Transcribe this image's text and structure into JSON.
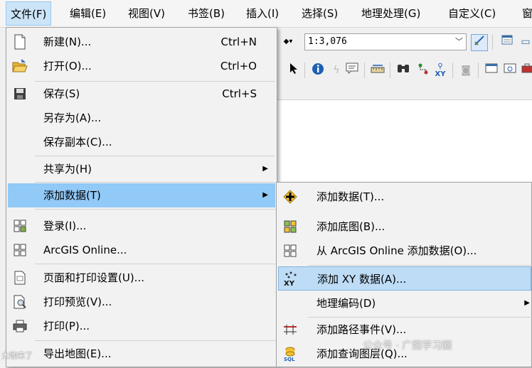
{
  "menubar": {
    "items": [
      "文件(F)",
      "编辑(E)",
      "视图(V)",
      "书签(B)",
      "插入(I)",
      "选择(S)",
      "地理处理(G)",
      "自定义(C)",
      "窗"
    ]
  },
  "toolbar": {
    "scale_value": "1:3,076"
  },
  "file_menu": {
    "items": [
      {
        "label": "新建(N)...",
        "shortcut": "Ctrl+N",
        "icon": "new-document-icon"
      },
      {
        "label": "打开(O)...",
        "shortcut": "Ctrl+O",
        "icon": "open-folder-icon"
      },
      {
        "label": "保存(S)",
        "shortcut": "Ctrl+S",
        "icon": "save-disk-icon"
      },
      {
        "label": "另存为(A)...",
        "shortcut": "",
        "icon": ""
      },
      {
        "label": "保存副本(C)...",
        "shortcut": "",
        "icon": ""
      },
      {
        "label": "共享为(H)",
        "shortcut": "",
        "icon": ""
      },
      {
        "label": "添加数据(T)",
        "shortcut": "",
        "icon": ""
      },
      {
        "label": "登录(I)...",
        "shortcut": "",
        "icon": "sign-in-grid-icon"
      },
      {
        "label": "ArcGIS Online...",
        "shortcut": "",
        "icon": "arcgis-grid-icon"
      },
      {
        "label": "页面和打印设置(U)...",
        "shortcut": "",
        "icon": "page-setup-icon"
      },
      {
        "label": "打印预览(V)...",
        "shortcut": "",
        "icon": "print-preview-icon"
      },
      {
        "label": "打印(P)...",
        "shortcut": "",
        "icon": "printer-icon"
      },
      {
        "label": "导出地图(E)...",
        "shortcut": "",
        "icon": ""
      }
    ]
  },
  "add_data_submenu": {
    "items": [
      {
        "label": "添加数据(T)...",
        "icon": "add-data-plus-icon"
      },
      {
        "label": "添加底图(B)...",
        "icon": "basemap-grid-icon"
      },
      {
        "label": "从 ArcGIS Online 添加数据(O)...",
        "icon": "arcgis-online-grid-icon"
      },
      {
        "label": "添加 XY 数据(A)...",
        "icon": "xy-data-icon"
      },
      {
        "label": "地理编码(D)",
        "icon": ""
      },
      {
        "label": "添加路径事件(V)...",
        "icon": "route-event-icon"
      },
      {
        "label": "添加查询图层(Q)...",
        "icon": "sql-query-icon"
      }
    ]
  },
  "watermarks": {
    "right": "公众号 · 广图学习圈",
    "left": "大咖来了"
  }
}
